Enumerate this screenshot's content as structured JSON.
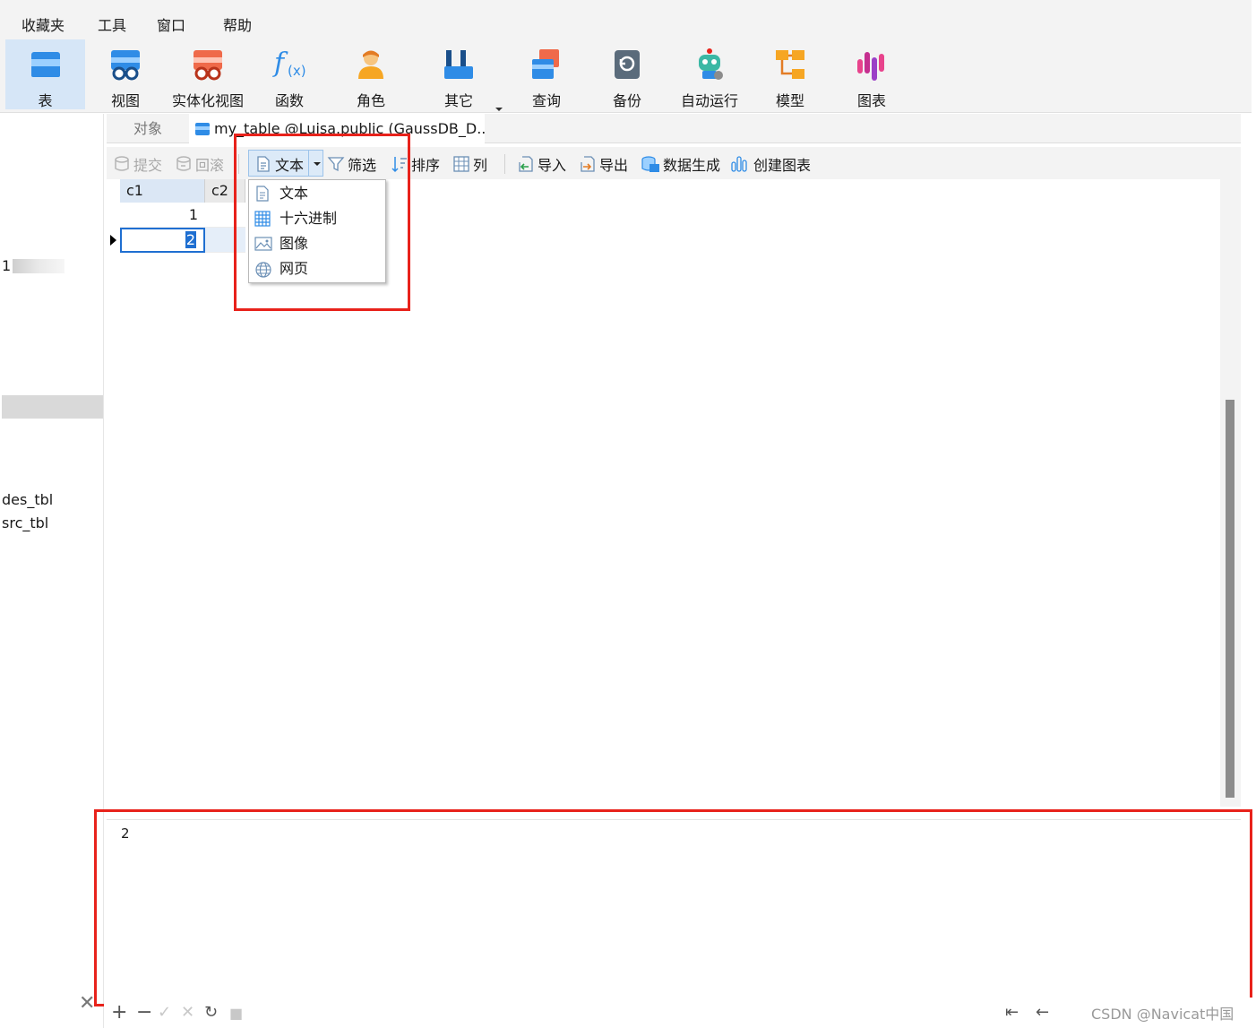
{
  "menu": {
    "items": [
      "收藏夹",
      "工具",
      "窗口",
      "帮助"
    ]
  },
  "ribbon": {
    "buttons": [
      {
        "label": "表",
        "icon": "table-icon"
      },
      {
        "label": "视图",
        "icon": "view-icon"
      },
      {
        "label": "实体化视图",
        "icon": "materialized-view-icon"
      },
      {
        "label": "函数",
        "icon": "function-icon"
      },
      {
        "label": "角色",
        "icon": "role-icon"
      },
      {
        "label": "其它",
        "icon": "tools-icon"
      },
      {
        "label": "查询",
        "icon": "query-icon"
      },
      {
        "label": "备份",
        "icon": "backup-icon"
      },
      {
        "label": "自动运行",
        "icon": "robot-icon"
      },
      {
        "label": "模型",
        "icon": "model-icon"
      },
      {
        "label": "图表",
        "icon": "chart-icon"
      }
    ],
    "active": "表"
  },
  "left_panel": {
    "partial_label": "1",
    "items": [
      "des_tbl",
      "src_tbl"
    ]
  },
  "tabs": {
    "objects": "对象",
    "active": "my_table @Luisa.public (GaussDB_D..."
  },
  "toolbar": {
    "commit": "提交",
    "rollback": "回滚",
    "text": "文本",
    "filter": "筛选",
    "sort": "排序",
    "columns": "列",
    "import": "导入",
    "export": "导出",
    "data_gen": "数据生成",
    "create_chart": "创建图表"
  },
  "grid": {
    "columns": [
      "c1",
      "c2"
    ],
    "rows": [
      [
        "1",
        ""
      ],
      [
        "2",
        ""
      ]
    ],
    "selected_value": "2"
  },
  "dropdown": {
    "items": [
      {
        "label": "文本",
        "icon": "text-doc-icon"
      },
      {
        "label": "十六进制",
        "icon": "hex-grid-icon"
      },
      {
        "label": "图像",
        "icon": "image-icon"
      },
      {
        "label": "网页",
        "icon": "globe-icon"
      }
    ]
  },
  "preview": {
    "value": "2"
  },
  "watermark": "CSDN @Navicat中国"
}
